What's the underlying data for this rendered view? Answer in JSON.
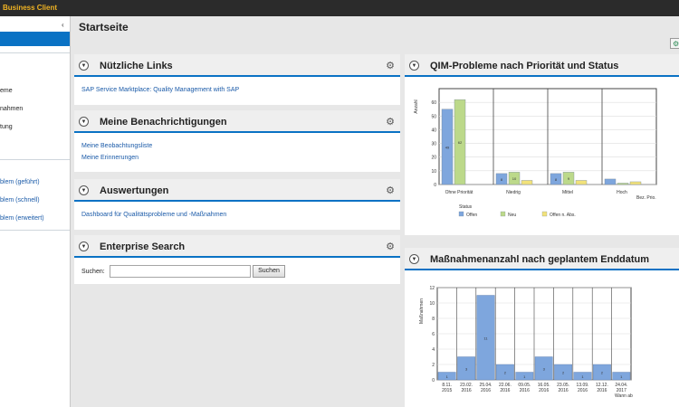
{
  "app": {
    "title": "Business Client"
  },
  "sidebar": {
    "items": [
      {
        "label": "eme"
      },
      {
        "label": "nahmen"
      },
      {
        "label": "tung"
      },
      {
        "label": ""
      },
      {
        "label": "blem (geführt)"
      },
      {
        "label": "blem (schnell)"
      },
      {
        "label": "blem (erweitert)"
      }
    ]
  },
  "page": {
    "title": "Startseite"
  },
  "panels": {
    "links": {
      "title": "Nützliche Links",
      "items": [
        "SAP Service Marktplace: Quality Management with SAP"
      ]
    },
    "notifications": {
      "title": "Meine Benachrichtigungen",
      "items": [
        "Meine Beobachtungsliste",
        "Meine Erinnerungen"
      ]
    },
    "reports": {
      "title": "Auswertungen",
      "items": [
        "Dashboard für Qualitätsprobleme und -Maßnahmen"
      ]
    },
    "search": {
      "title": "Enterprise Search",
      "label": "Suchen:",
      "value": "",
      "button": "Suchen"
    },
    "chart1": {
      "title": "QIM-Probleme nach Priorität und Status"
    },
    "chart2": {
      "title": "Maßnahmenanzahl nach geplantem Enddatum"
    }
  },
  "colors": {
    "accent": "#0a72c4",
    "bar_blue": "#7ea6dd",
    "bar_green": "#bcd98a",
    "bar_yellow": "#f2e27a"
  },
  "chart_data": [
    {
      "type": "bar",
      "title": "QIM-Probleme nach Priorität und Status",
      "ylabel": "Anzahl",
      "xlabel": "Bez. Prio.",
      "categories": [
        "Ohne Priorität",
        "Niedrig",
        "Mittel",
        "Hoch"
      ],
      "ylim": [
        0,
        70
      ],
      "yticks": [
        0,
        10,
        20,
        30,
        40,
        50,
        60
      ],
      "legend_title": "Status",
      "legend_position": "bottom",
      "series": [
        {
          "name": "Offen",
          "color": "#7ea6dd",
          "values": [
            55,
            8,
            8,
            4
          ],
          "labels": [
            "49",
            "8",
            "8",
            ""
          ]
        },
        {
          "name": "Neu",
          "color": "#bcd98a",
          "values": [
            62,
            9,
            9,
            1
          ],
          "labels": [
            "62",
            "10",
            "9",
            ""
          ]
        },
        {
          "name": "Offen n. Abs.",
          "color": "#f2e27a",
          "values": [
            0,
            3,
            3,
            2
          ],
          "labels": [
            "",
            "",
            "",
            ""
          ]
        }
      ]
    },
    {
      "type": "bar",
      "title": "Maßnahmenanzahl nach geplantem Enddatum",
      "ylabel": "Maßnahmen",
      "xlabel": "Wann ab",
      "categories": [
        "8.11.\n2015",
        "23.02.\n2016",
        "25.04.\n2016",
        "22.06.\n2016",
        "09.05.\n2016",
        "16.05.\n2016",
        "23.05.\n2016",
        "13.09.\n2016",
        "12.12.\n2016",
        "24.04.\n2017"
      ],
      "values": [
        1,
        3,
        11,
        2,
        1,
        3,
        2,
        1,
        2,
        1
      ],
      "value_labels": [
        "1",
        "3",
        "11",
        "2",
        "1",
        "3",
        "2",
        "1",
        "2",
        "1"
      ],
      "ylim": [
        0,
        12
      ],
      "yticks": [
        0,
        2,
        4,
        6,
        8,
        10,
        12
      ],
      "color": "#7ea6dd"
    }
  ]
}
